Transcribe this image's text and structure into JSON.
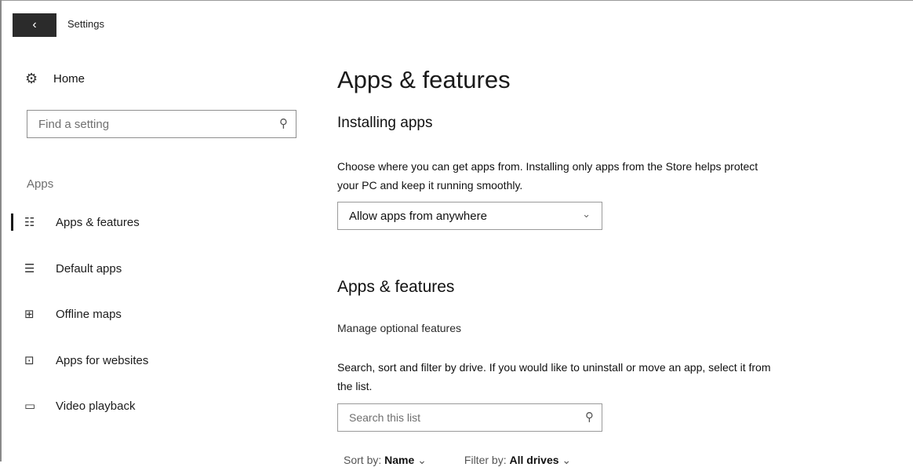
{
  "window": {
    "title": "Settings",
    "back_icon": "back-arrow-icon"
  },
  "sidebar": {
    "home_label": "Home",
    "search_placeholder": "Find a setting",
    "group_label": "Apps",
    "items": [
      {
        "label": "Apps & features",
        "icon": "apps-list-icon",
        "icon_glyph": "☷",
        "selected": true
      },
      {
        "label": "Default apps",
        "icon": "default-apps-icon",
        "icon_glyph": "☰",
        "selected": false
      },
      {
        "label": "Offline maps",
        "icon": "map-icon",
        "icon_glyph": "⊞",
        "selected": false
      },
      {
        "label": "Apps for websites",
        "icon": "web-app-icon",
        "icon_glyph": "⊡",
        "selected": false
      },
      {
        "label": "Video playback",
        "icon": "video-icon",
        "icon_glyph": "▭",
        "selected": false
      }
    ]
  },
  "main": {
    "page_title": "Apps & features",
    "installing_heading": "Installing apps",
    "installing_desc": "Choose where you can get apps from. Installing only apps from the Store helps protect your PC and keep it running smoothly.",
    "source_dropdown_value": "Allow apps from anywhere",
    "apps_heading": "Apps & features",
    "manage_link": "Manage optional features",
    "search_desc": "Search, sort and filter by drive. If you would like to uninstall or move an app, select it from the list.",
    "search_placeholder": "Search this list",
    "sort_label": "Sort by:",
    "sort_value": "Name",
    "filter_label": "Filter by:",
    "filter_value": "All drives"
  }
}
